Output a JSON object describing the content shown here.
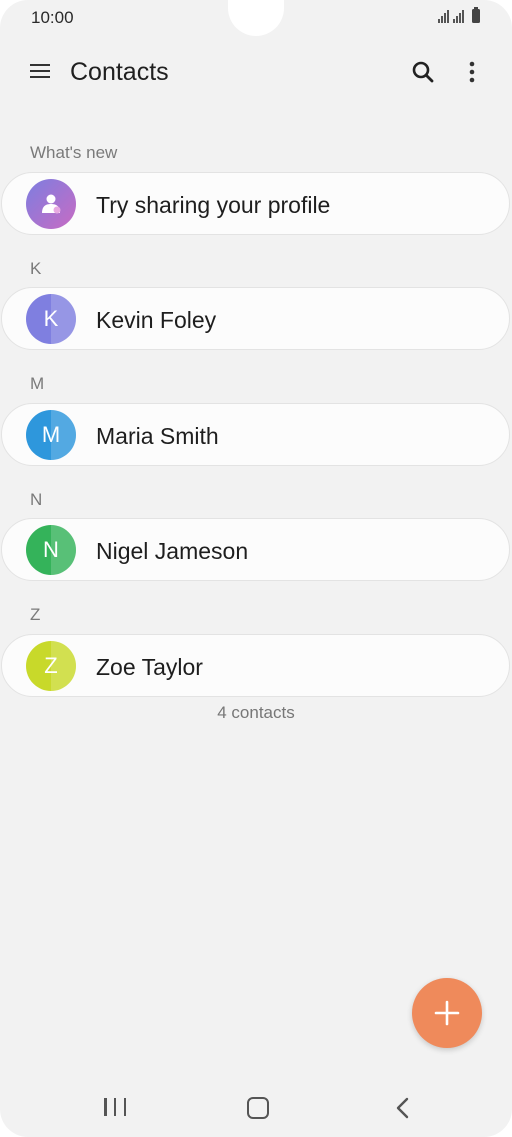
{
  "status_bar": {
    "time": "10:00"
  },
  "app_bar": {
    "title": "Contacts"
  },
  "sections": [
    {
      "header": "What's new",
      "item": {
        "label": "Try sharing your profile",
        "avatar_letter": "",
        "avatar_color": "#8f6fd8"
      }
    },
    {
      "header": "K",
      "item": {
        "label": "Kevin Foley",
        "avatar_letter": "K",
        "avatar_color": "#7f7fe0"
      }
    },
    {
      "header": "M",
      "item": {
        "label": "Maria Smith",
        "avatar_letter": "M",
        "avatar_color": "#2e97dc"
      }
    },
    {
      "header": "N",
      "item": {
        "label": "Nigel Jameson",
        "avatar_letter": "N",
        "avatar_color": "#34b35a"
      }
    },
    {
      "header": "Z",
      "item": {
        "label": "Zoe Taylor",
        "avatar_letter": "Z",
        "avatar_color": "#c8d92a"
      }
    }
  ],
  "footer": {
    "count_text": "4 contacts"
  },
  "fab": {
    "icon": "plus-icon",
    "color": "#ef8a5b"
  },
  "nav": {
    "recents_icon": "recents-icon",
    "home_icon": "home-icon",
    "back_icon": "back-icon"
  }
}
